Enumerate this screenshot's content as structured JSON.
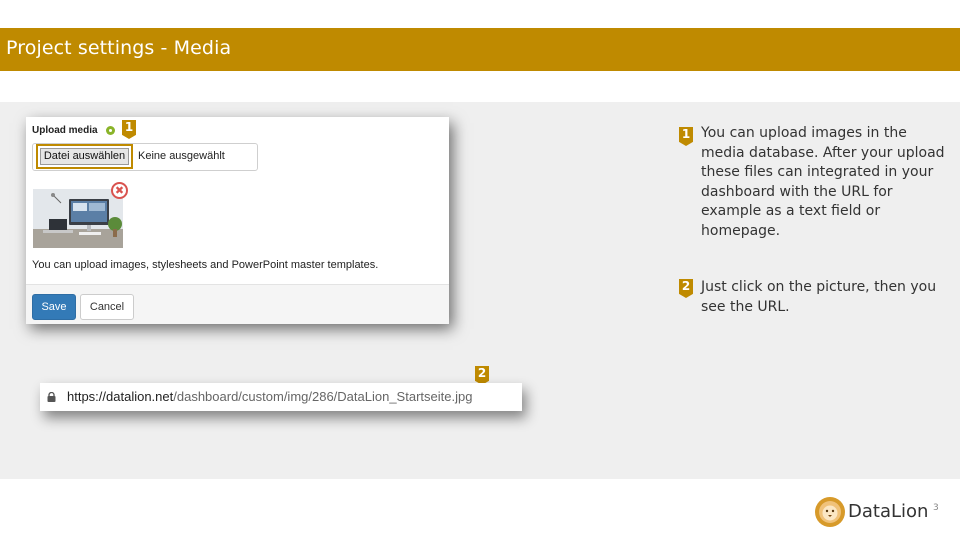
{
  "slide": {
    "title": "Project settings - Media",
    "page_number": "3"
  },
  "media_panel": {
    "label": "Upload media",
    "file_button": "Datei auswählen",
    "file_status": "Keine ausgewählt",
    "help_text": "You can upload images, stylesheets and PowerPoint master templates.",
    "save_label": "Save",
    "cancel_label": "Cancel",
    "remove_icon": "✖"
  },
  "url_bar": {
    "host": "https://datalion.net",
    "path": "/dashboard/custom/img/286/DataLion_Startseite.jpg"
  },
  "markers": [
    "1",
    "2"
  ],
  "notes": [
    {
      "number": "1",
      "text": "You can upload images in the media database. After your upload these files can integrated in your dashboard with the URL for example as a text field or homepage."
    },
    {
      "number": "2",
      "text": "Just click on the picture, then you see the URL."
    }
  ],
  "brand": {
    "name": "DataLion",
    "accent_color": "#bf8a00",
    "primary_button_color": "#337ab7"
  }
}
